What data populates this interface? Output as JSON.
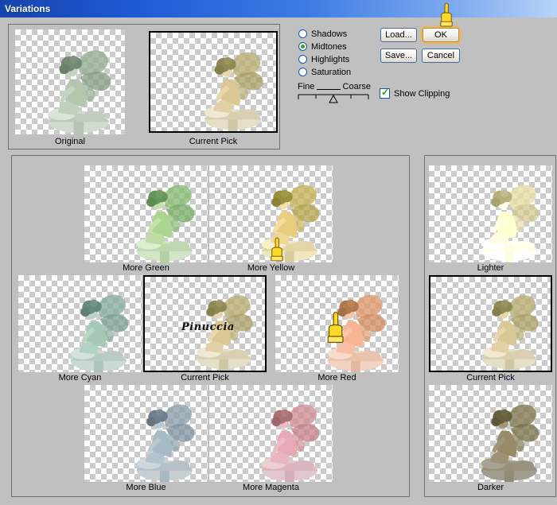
{
  "window": {
    "title": "Variations"
  },
  "preview": {
    "original_label": "Original",
    "current_label": "Current Pick"
  },
  "controls": {
    "radios": [
      {
        "label": "Shadows",
        "selected": false
      },
      {
        "label": "Midtones",
        "selected": true
      },
      {
        "label": "Highlights",
        "selected": false
      },
      {
        "label": "Saturation",
        "selected": false
      }
    ],
    "load_label": "Load...",
    "ok_label": "OK",
    "save_label": "Save...",
    "cancel_label": "Cancel",
    "slider": {
      "left_label": "Fine",
      "right_label": "Coarse"
    },
    "clipping": {
      "label": "Show Clipping",
      "checked": true
    }
  },
  "grid": {
    "cells": [
      {
        "label": "More Green",
        "tint": "green"
      },
      {
        "label": "More Yellow",
        "tint": "yellow"
      },
      {
        "label": "More Cyan",
        "tint": "cyan"
      },
      {
        "label": "Current Pick",
        "tint": "current",
        "watermark": "Pinuccia"
      },
      {
        "label": "More Red",
        "tint": "red"
      },
      {
        "label": "More Blue",
        "tint": "blue"
      },
      {
        "label": "More Magenta",
        "tint": "magenta"
      }
    ]
  },
  "lightness": {
    "cells": [
      {
        "label": "Lighter",
        "tint": "lighter"
      },
      {
        "label": "Current Pick",
        "tint": "current"
      },
      {
        "label": "Darker",
        "tint": "darker"
      }
    ]
  },
  "colors": {
    "titlebar_blue": "#1e5bd6",
    "dialog_gray": "#c0c0c0",
    "focus_orange": "#f5b240",
    "check_green": "#21a121"
  }
}
